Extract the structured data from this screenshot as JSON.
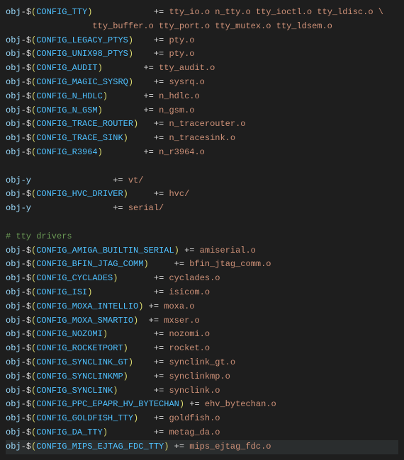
{
  "lines": [
    {
      "type": "rule",
      "lhs": "obj",
      "var": "CONFIG_TTY",
      "pad": 11,
      "rhs": "tty_io.o n_tty.o tty_ioctl.o tty_ldisc.o \\"
    },
    {
      "type": "cont",
      "rhs": "tty_buffer.o tty_port.o tty_mutex.o tty_ldsem.o"
    },
    {
      "type": "rule",
      "lhs": "obj",
      "var": "CONFIG_LEGACY_PTYS",
      "pad": 3,
      "rhs": "pty.o"
    },
    {
      "type": "rule",
      "lhs": "obj",
      "var": "CONFIG_UNIX98_PTYS",
      "pad": 3,
      "rhs": "pty.o"
    },
    {
      "type": "rule",
      "lhs": "obj",
      "var": "CONFIG_AUDIT",
      "pad": 7,
      "rhs": "tty_audit.o"
    },
    {
      "type": "rule",
      "lhs": "obj",
      "var": "CONFIG_MAGIC_SYSRQ",
      "pad": 3,
      "rhs": "sysrq.o"
    },
    {
      "type": "rule",
      "lhs": "obj",
      "var": "CONFIG_N_HDLC",
      "pad": 6,
      "rhs": "n_hdlc.o"
    },
    {
      "type": "rule",
      "lhs": "obj",
      "var": "CONFIG_N_GSM",
      "pad": 7,
      "rhs": "n_gsm.o"
    },
    {
      "type": "rule",
      "lhs": "obj",
      "var": "CONFIG_TRACE_ROUTER",
      "pad": 2,
      "rhs": "n_tracerouter.o"
    },
    {
      "type": "rule",
      "lhs": "obj",
      "var": "CONFIG_TRACE_SINK",
      "pad": 4,
      "rhs": "n_tracesink.o"
    },
    {
      "type": "rule",
      "lhs": "obj",
      "var": "CONFIG_R3964",
      "pad": 7,
      "rhs": "n_r3964.o"
    },
    {
      "type": "blank"
    },
    {
      "type": "objy",
      "pad": 15,
      "rhs": "vt/"
    },
    {
      "type": "rule",
      "lhs": "obj",
      "var": "CONFIG_HVC_DRIVER",
      "pad": 4,
      "rhs": "hvc/"
    },
    {
      "type": "objy",
      "pad": 15,
      "rhs": "serial/"
    },
    {
      "type": "blank"
    },
    {
      "type": "comment",
      "text": "# tty drivers"
    },
    {
      "type": "rule",
      "lhs": "obj",
      "var": "CONFIG_AMIGA_BUILTIN_SERIAL",
      "pad": 0,
      "rhs": "amiserial.o"
    },
    {
      "type": "rule",
      "lhs": "obj",
      "var": "CONFIG_BFIN_JTAG_COMM",
      "pad": 4,
      "rhs": "bfin_jtag_comm.o"
    },
    {
      "type": "rule",
      "lhs": "obj",
      "var": "CONFIG_CYCLADES",
      "pad": 6,
      "rhs": "cyclades.o"
    },
    {
      "type": "rule",
      "lhs": "obj",
      "var": "CONFIG_ISI",
      "pad": 11,
      "rhs": "isicom.o"
    },
    {
      "type": "rule",
      "lhs": "obj",
      "var": "CONFIG_MOXA_INTELLIO",
      "pad": 0,
      "rhs": "moxa.o"
    },
    {
      "type": "rule",
      "lhs": "obj",
      "var": "CONFIG_MOXA_SMARTIO",
      "pad": 1,
      "rhs": "mxser.o"
    },
    {
      "type": "rule",
      "lhs": "obj",
      "var": "CONFIG_NOZOMI",
      "pad": 8,
      "rhs": "nozomi.o"
    },
    {
      "type": "rule",
      "lhs": "obj",
      "var": "CONFIG_ROCKETPORT",
      "pad": 4,
      "rhs": "rocket.o"
    },
    {
      "type": "rule",
      "lhs": "obj",
      "var": "CONFIG_SYNCLINK_GT",
      "pad": 3,
      "rhs": "synclink_gt.o"
    },
    {
      "type": "rule",
      "lhs": "obj",
      "var": "CONFIG_SYNCLINKMP",
      "pad": 4,
      "rhs": "synclinkmp.o"
    },
    {
      "type": "rule",
      "lhs": "obj",
      "var": "CONFIG_SYNCLINK",
      "pad": 6,
      "rhs": "synclink.o"
    },
    {
      "type": "rule",
      "lhs": "obj",
      "var": "CONFIG_PPC_EPAPR_HV_BYTECHAN",
      "pad": 0,
      "rhs": "ehv_bytechan.o"
    },
    {
      "type": "rule",
      "lhs": "obj",
      "var": "CONFIG_GOLDFISH_TTY",
      "pad": 2,
      "rhs": "goldfish.o"
    },
    {
      "type": "rule",
      "lhs": "obj",
      "var": "CONFIG_DA_TTY",
      "pad": 8,
      "rhs": "metag_da.o"
    },
    {
      "type": "rule",
      "lhs": "obj",
      "var": "CONFIG_MIPS_EJTAG_FDC_TTY",
      "pad": 0,
      "rhs": "mips_ejtag_fdc.o",
      "highlight": true
    }
  ],
  "highlight_index": 31
}
